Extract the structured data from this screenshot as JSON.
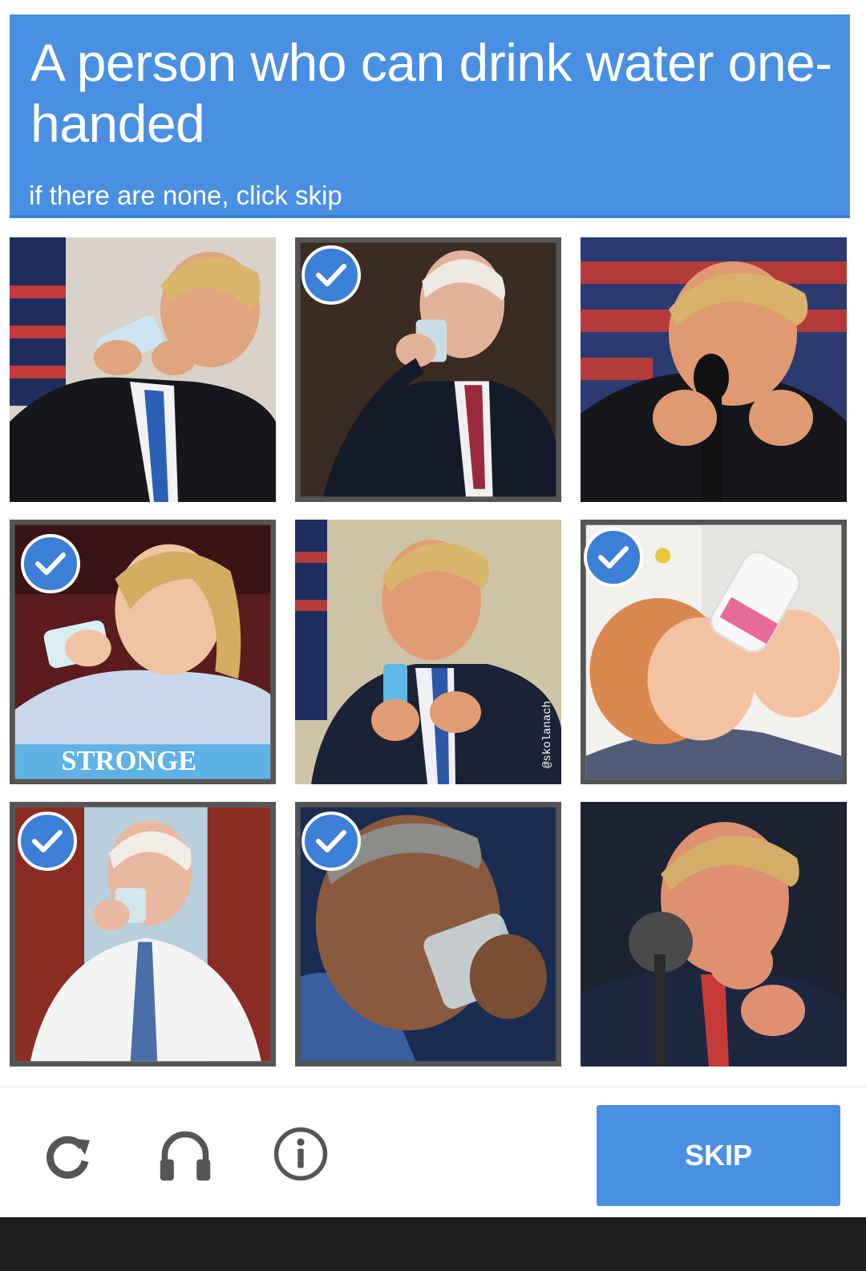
{
  "challenge": {
    "title": "A person who can drink water one-handed",
    "subtitle": "if there are none, click skip"
  },
  "tiles": [
    {
      "subject": "man in suit drinking water bottle with both hands",
      "selected": false
    },
    {
      "subject": "man in suit drinking glass with one hand",
      "selected": true
    },
    {
      "subject": "man at microphone drinking glass with both hands",
      "selected": false
    },
    {
      "subject": "woman drinking glass with one hand",
      "selected": true,
      "caption": "STRONGE"
    },
    {
      "subject": "man holding water bottle with both hands",
      "selected": false,
      "caption": "@skolanach"
    },
    {
      "subject": "baby drinking from bottle",
      "selected": true
    },
    {
      "subject": "man in office drinking glass with one hand",
      "selected": true
    },
    {
      "subject": "man drinking glass with one hand close-up",
      "selected": true
    },
    {
      "subject": "man at microphone drinking glass with both hands",
      "selected": false
    }
  ],
  "controls": {
    "reload_icon": "reload-icon",
    "audio_icon": "headphones-icon",
    "info_icon": "info-icon",
    "skip_label": "SKIP"
  },
  "colors": {
    "accent": "#4a90e2",
    "check": "#3c7fd6"
  }
}
